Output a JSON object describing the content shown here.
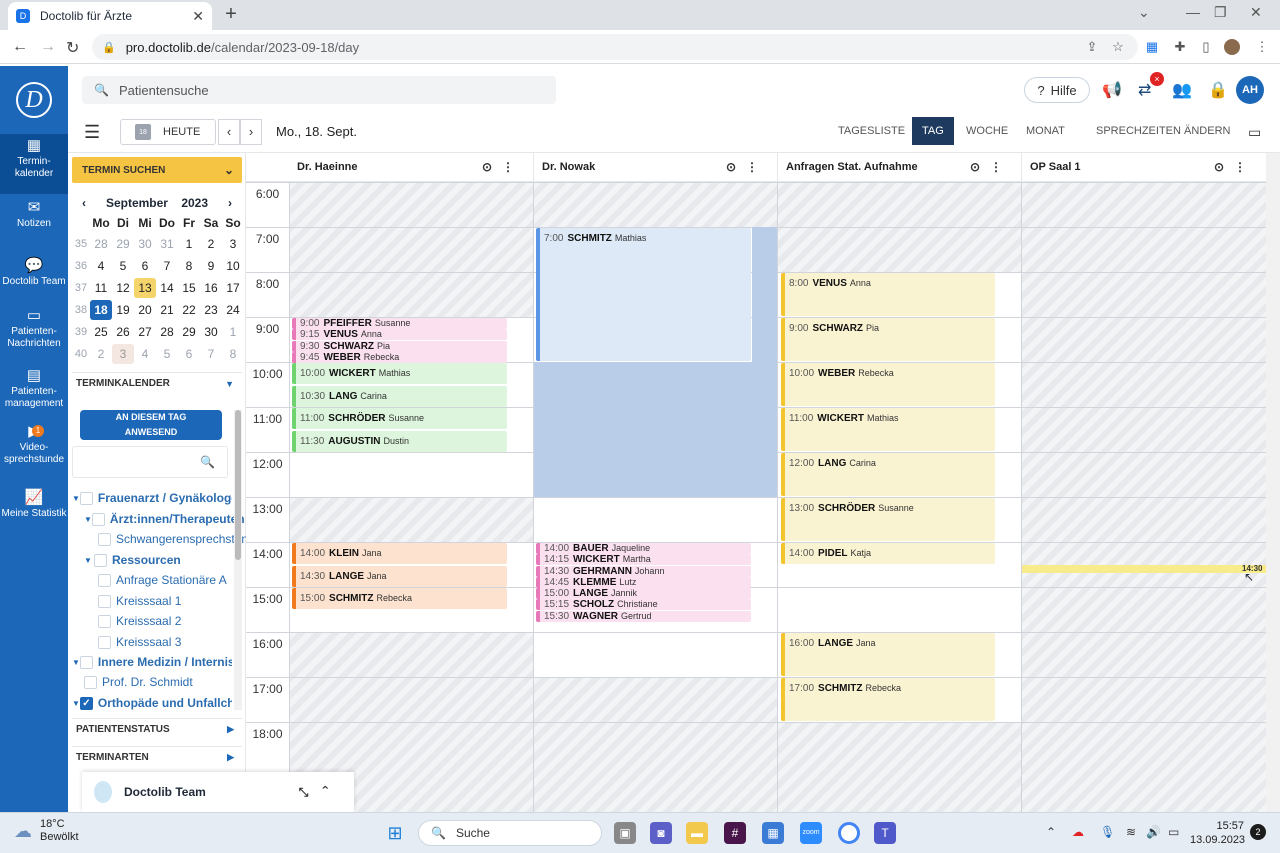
{
  "browser": {
    "tab_title": "Doctolib für Ärzte",
    "url_host": "pro.doctolib.de",
    "url_path": "/calendar/2023-09-18/day"
  },
  "sidebar": {
    "items": [
      {
        "label": "Termin-\nkalender",
        "icon": "calendar-icon"
      },
      {
        "label": "Notizen",
        "icon": "mail-icon"
      },
      {
        "label": "Doctolib Team",
        "icon": "chat-icon"
      },
      {
        "label": "Patienten-\nNachrichten",
        "icon": "message-icon"
      },
      {
        "label": "Patienten-\nmanagement",
        "icon": "clipboard-icon"
      },
      {
        "label": "Video-\nsprechstunde",
        "icon": "video-icon",
        "badge": "1"
      },
      {
        "label": "Meine Statistik",
        "icon": "stats-icon"
      }
    ]
  },
  "header": {
    "search_placeholder": "Patientensuche",
    "help_label": "Hilfe",
    "avatar_initials": "AH",
    "notif_badge": "×"
  },
  "toolbar": {
    "today_label": "HEUTE",
    "today_day": "18",
    "date_label": "Mo., 18. Sept.",
    "views": [
      "TAGESLISTE",
      "TAG",
      "WOCHE",
      "MONAT",
      "SPRECHZEITEN ÄNDERN"
    ],
    "active_view": "TAG"
  },
  "left": {
    "termin_suchen": "TERMIN SUCHEN",
    "month": "September",
    "year": "2023",
    "weekdays": [
      "Mo",
      "Di",
      "Mi",
      "Do",
      "Fr",
      "Sa",
      "So"
    ],
    "weeks": [
      {
        "wk": "35",
        "days": [
          "28",
          "29",
          "30",
          "31",
          "1",
          "2",
          "3"
        ]
      },
      {
        "wk": "36",
        "days": [
          "4",
          "5",
          "6",
          "7",
          "8",
          "9",
          "10"
        ]
      },
      {
        "wk": "37",
        "days": [
          "11",
          "12",
          "13",
          "14",
          "15",
          "16",
          "17"
        ]
      },
      {
        "wk": "38",
        "days": [
          "18",
          "19",
          "20",
          "21",
          "22",
          "23",
          "24"
        ]
      },
      {
        "wk": "39",
        "days": [
          "25",
          "26",
          "27",
          "28",
          "29",
          "30",
          "1"
        ]
      },
      {
        "wk": "40",
        "days": [
          "2",
          "3",
          "4",
          "5",
          "6",
          "7",
          "8"
        ]
      }
    ],
    "section_terminkalender": "TERMINKALENDER",
    "anwesend_label": "AN DIESEM TAG ANWESEND",
    "tree": [
      "Frauenarzt / Gynäkologe",
      "Ärzt:innen/Therapeuten",
      "Schwangerensprechstunde",
      "Ressourcen",
      "Anfrage Stationäre A",
      "Kreisssaal 1",
      "Kreisssaal 2",
      "Kreisssaal 3",
      "Innere Medizin / Internist",
      "Prof. Dr. Schmidt",
      "Orthopäde und Unfallchirurg"
    ],
    "section_patientenstatus": "PATIENTENSTATUS",
    "section_terminarten": "TERMINARTEN",
    "team_chat": "Doctolib Team"
  },
  "calendar": {
    "columns": [
      "Dr. Haeinne",
      "Dr. Nowak",
      "Anfragen Stat. Aufnahme",
      "OP Saal 1"
    ],
    "hours": [
      "6:00",
      "7:00",
      "8:00",
      "9:00",
      "10:00",
      "11:00",
      "12:00",
      "13:00",
      "14:00",
      "15:00",
      "16:00",
      "17:00",
      "18:00"
    ],
    "now_label": "14:30",
    "appointments": {
      "col1": [
        {
          "time": "9:00",
          "last": "PFEIFFER",
          "first": "Susanne"
        },
        {
          "time": "9:15",
          "last": "VENUS",
          "first": "Anna"
        },
        {
          "time": "9:30",
          "last": "SCHWARZ",
          "first": "Pia"
        },
        {
          "time": "9:45",
          "last": "WEBER",
          "first": "Rebecka"
        },
        {
          "time": "10:00",
          "last": "WICKERT",
          "first": "Mathias"
        },
        {
          "time": "10:30",
          "last": "LANG",
          "first": "Carina"
        },
        {
          "time": "11:00",
          "last": "SCHRÖDER",
          "first": "Susanne"
        },
        {
          "time": "11:30",
          "last": "AUGUSTIN",
          "first": "Dustin"
        },
        {
          "time": "14:00",
          "last": "KLEIN",
          "first": "Jana"
        },
        {
          "time": "14:30",
          "last": "LANGE",
          "first": "Jana"
        },
        {
          "time": "15:00",
          "last": "SCHMITZ",
          "first": "Rebecka"
        }
      ],
      "col2": [
        {
          "time": "7:00",
          "last": "SCHMITZ",
          "first": "Mathias"
        },
        {
          "time": "14:00",
          "last": "BAUER",
          "first": "Jaqueline"
        },
        {
          "time": "14:15",
          "last": "WICKERT",
          "first": "Martha"
        },
        {
          "time": "14:30",
          "last": "GEHRMANN",
          "first": "Johann"
        },
        {
          "time": "14:45",
          "last": "KLEMME",
          "first": "Lutz"
        },
        {
          "time": "15:00",
          "last": "LANGE",
          "first": "Jannik"
        },
        {
          "time": "15:15",
          "last": "SCHOLZ",
          "first": "Christiane"
        },
        {
          "time": "15:30",
          "last": "WAGNER",
          "first": "Gertrud"
        }
      ],
      "col3": [
        {
          "time": "8:00",
          "last": "VENUS",
          "first": "Anna"
        },
        {
          "time": "9:00",
          "last": "SCHWARZ",
          "first": "Pia"
        },
        {
          "time": "10:00",
          "last": "WEBER",
          "first": "Rebecka"
        },
        {
          "time": "11:00",
          "last": "WICKERT",
          "first": "Mathias"
        },
        {
          "time": "12:00",
          "last": "LANG",
          "first": "Carina"
        },
        {
          "time": "13:00",
          "last": "SCHRÖDER",
          "first": "Susanne"
        },
        {
          "time": "14:00",
          "last": "PIDEL",
          "first": "Katja"
        },
        {
          "time": "16:00",
          "last": "LANGE",
          "first": "Jana"
        },
        {
          "time": "17:00",
          "last": "SCHMITZ",
          "first": "Rebecka"
        }
      ]
    }
  },
  "taskbar": {
    "temp": "18°C",
    "weather": "Bewölkt",
    "search_label": "Suche",
    "time": "15:57",
    "date": "13.09.2023",
    "notif_count": "2"
  }
}
